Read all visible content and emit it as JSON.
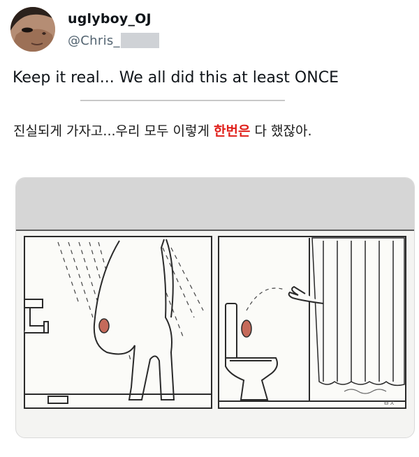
{
  "tweet": {
    "display_name": "uglyboy_OJ",
    "handle": "@Chris_",
    "avatar_icon": "profile-avatar-face"
  },
  "body": {
    "english": "Keep it real... We all did this at least ONCE",
    "korean_before": "진실되게 가자고...우리 모두 이렇게 ",
    "korean_highlight": "한번은",
    "korean_after": " 다 했잖아."
  },
  "colors": {
    "highlight": "#e0201b",
    "handle_gray": "#536471"
  },
  "media": {
    "panels": [
      "shower-panel",
      "toilet-panel"
    ]
  }
}
